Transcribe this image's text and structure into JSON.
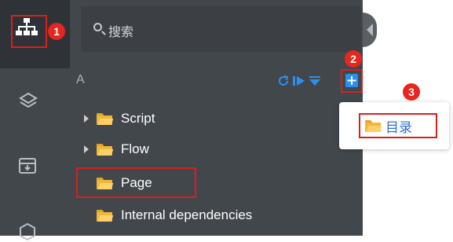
{
  "search": {
    "placeholder": "搜索"
  },
  "tree": {
    "section_label": "A",
    "items": [
      {
        "label": "Script",
        "expandable": true
      },
      {
        "label": "Flow",
        "expandable": true
      },
      {
        "label": "Page",
        "expandable": false
      },
      {
        "label": "Internal dependencies",
        "expandable": false
      }
    ]
  },
  "toolbar": {
    "icons": [
      "refresh-icon",
      "run-icon",
      "filter-icon",
      "add-icon"
    ]
  },
  "rail": {
    "icons": [
      "org-tree-icon",
      "layers-icon",
      "archive-icon",
      "cube-icon"
    ]
  },
  "popup_menu": {
    "items": [
      {
        "label": "目录",
        "icon": "folder-icon"
      }
    ]
  },
  "annotations": {
    "badges": [
      "1",
      "2",
      "3"
    ]
  },
  "colors": {
    "accent": "#2a8ff0",
    "highlight_box": "#d62020",
    "folder": "#f0b73a"
  }
}
